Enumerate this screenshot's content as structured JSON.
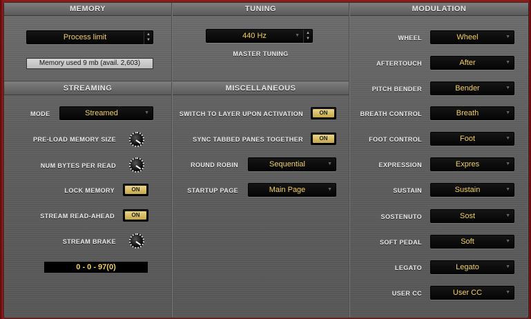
{
  "memory": {
    "title": "MEMORY",
    "process_limit": "Process limit",
    "memory_used": "Memory used 9 mb (avail. 2,603)"
  },
  "tuning": {
    "title": "TUNING",
    "value": "440 Hz",
    "label": "MASTER TUNING"
  },
  "modulation": {
    "title": "MODULATION",
    "rows": [
      {
        "label": "WHEEL",
        "value": "Wheel"
      },
      {
        "label": "AFTERTOUCH",
        "value": "After"
      },
      {
        "label": "PITCH BENDER",
        "value": "Bender"
      },
      {
        "label": "BREATH CONTROL",
        "value": "Breath"
      },
      {
        "label": "FOOT CONTROL",
        "value": "Foot"
      },
      {
        "label": "EXPRESSION",
        "value": "Expres"
      },
      {
        "label": "SUSTAIN",
        "value": "Sustain"
      },
      {
        "label": "SOSTENUTO",
        "value": "Sost"
      },
      {
        "label": "SOFT PEDAL",
        "value": "Soft"
      },
      {
        "label": "LEGATO",
        "value": "Legato"
      },
      {
        "label": "USER CC",
        "value": "User CC"
      }
    ]
  },
  "streaming": {
    "title": "STREAMING",
    "mode_label": "MODE",
    "mode_value": "Streamed",
    "preload_label": "PRE-LOAD MEMORY SIZE",
    "numbytes_label": "NUM BYTES PER READ",
    "lock_label": "LOCK MEMORY",
    "lock_value": "ON",
    "readahead_label": "STREAM READ-AHEAD",
    "readahead_value": "ON",
    "brake_label": "STREAM BRAKE",
    "readout": "0 - 0 - 97(0)"
  },
  "misc": {
    "title": "MISCELLANEOUS",
    "switch_label": "SWITCH TO LAYER UPON ACTIVATION",
    "switch_value": "ON",
    "sync_label": "SYNC TABBED PANES TOGETHER",
    "sync_value": "ON",
    "round_robin_label": "ROUND ROBIN",
    "round_robin_value": "Sequential",
    "startup_label": "STARTUP  PAGE",
    "startup_value": "Main Page"
  },
  "icons": {
    "dropdown_arrow": "chevron-down-icon",
    "spinner": "spinner-arrows-icon",
    "knob": "rotary-knob-icon"
  }
}
